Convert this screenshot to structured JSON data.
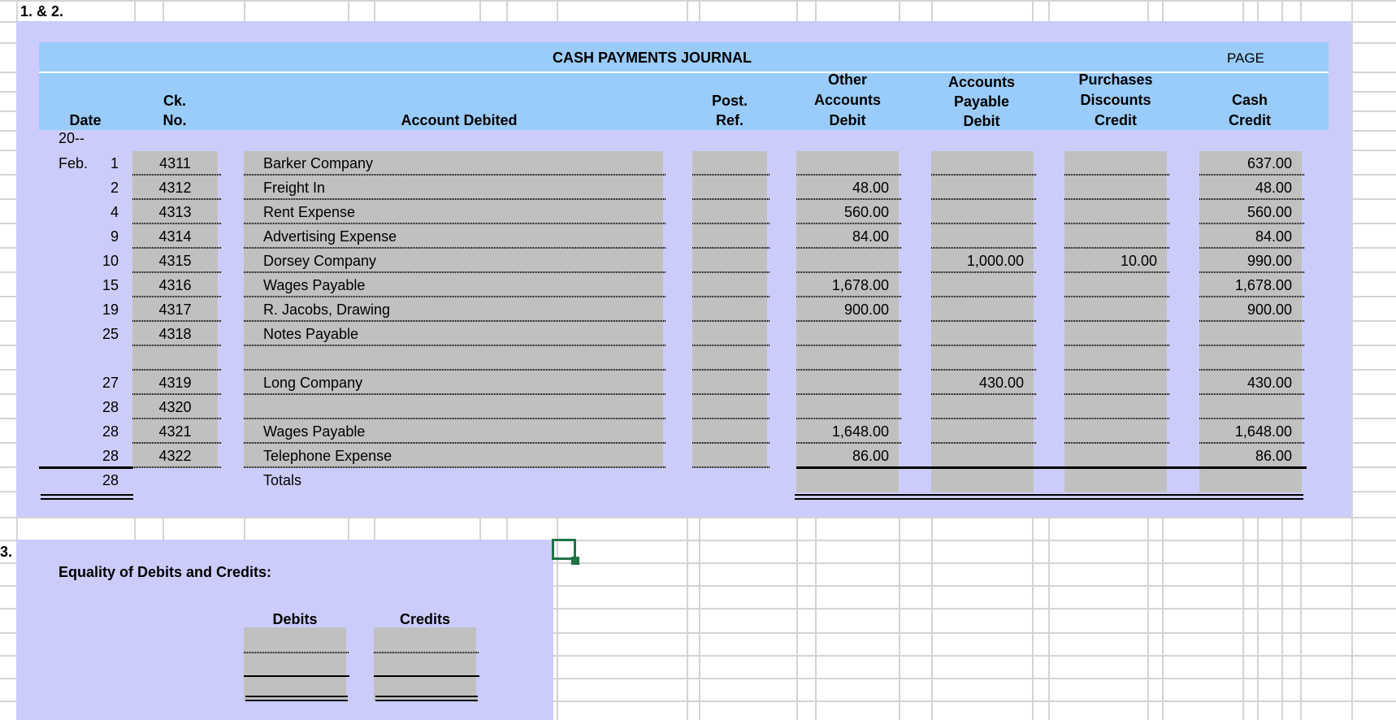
{
  "labels": {
    "part_1_2": "1. & 2.",
    "part_3": "3."
  },
  "journal": {
    "title": "CASH PAYMENTS JOURNAL",
    "page_label": "PAGE",
    "headers": {
      "date": "Date",
      "ck_line1": "Ck.",
      "ck_line2": "No.",
      "account": "Account Debited",
      "post_line1": "Post.",
      "post_line2": "Ref.",
      "other_line1": "Other",
      "other_line2": "Accounts",
      "other_line3": "Debit",
      "ap_line1": "Accounts",
      "ap_line2": "Payable",
      "ap_line3": "Debit",
      "pd_line1": "Purchases",
      "pd_line2": "Discounts",
      "pd_line3": "Credit",
      "cash_line1": "Cash",
      "cash_line2": "Credit"
    },
    "year": "20--",
    "rows": [
      {
        "month": "Feb.",
        "day": "1",
        "ck": "4311",
        "account": "Barker Company",
        "post": "",
        "other": "",
        "ap": "",
        "pd": "",
        "cash": "637.00"
      },
      {
        "month": "",
        "day": "2",
        "ck": "4312",
        "account": "Freight In",
        "post": "",
        "other": "48.00",
        "ap": "",
        "pd": "",
        "cash": "48.00"
      },
      {
        "month": "",
        "day": "4",
        "ck": "4313",
        "account": "Rent Expense",
        "post": "",
        "other": "560.00",
        "ap": "",
        "pd": "",
        "cash": "560.00"
      },
      {
        "month": "",
        "day": "9",
        "ck": "4314",
        "account": "Advertising Expense",
        "post": "",
        "other": "84.00",
        "ap": "",
        "pd": "",
        "cash": "84.00"
      },
      {
        "month": "",
        "day": "10",
        "ck": "4315",
        "account": "Dorsey Company",
        "post": "",
        "other": "",
        "ap": "1,000.00",
        "pd": "10.00",
        "cash": "990.00"
      },
      {
        "month": "",
        "day": "15",
        "ck": "4316",
        "account": "Wages Payable",
        "post": "",
        "other": "1,678.00",
        "ap": "",
        "pd": "",
        "cash": "1,678.00"
      },
      {
        "month": "",
        "day": "19",
        "ck": "4317",
        "account": "R. Jacobs, Drawing",
        "post": "",
        "other": "900.00",
        "ap": "",
        "pd": "",
        "cash": "900.00"
      },
      {
        "month": "",
        "day": "25",
        "ck": "4318",
        "account": "Notes Payable",
        "post": "",
        "other": "",
        "ap": "",
        "pd": "",
        "cash": ""
      },
      {
        "month": "",
        "day": "",
        "ck": "",
        "account": "",
        "post": "",
        "other": "",
        "ap": "",
        "pd": "",
        "cash": ""
      },
      {
        "month": "",
        "day": "27",
        "ck": "4319",
        "account": "Long Company",
        "post": "",
        "other": "",
        "ap": "430.00",
        "pd": "",
        "cash": "430.00"
      },
      {
        "month": "",
        "day": "28",
        "ck": "4320",
        "account": "",
        "post": "",
        "other": "",
        "ap": "",
        "pd": "",
        "cash": ""
      },
      {
        "month": "",
        "day": "28",
        "ck": "4321",
        "account": "Wages Payable",
        "post": "",
        "other": "1,648.00",
        "ap": "",
        "pd": "",
        "cash": "1,648.00"
      },
      {
        "month": "",
        "day": "28",
        "ck": "4322",
        "account": "Telephone Expense",
        "post": "",
        "other": "86.00",
        "ap": "",
        "pd": "",
        "cash": "86.00"
      }
    ],
    "totals": {
      "day": "28",
      "label": "Totals",
      "other": "",
      "ap": "",
      "pd": "",
      "cash": ""
    }
  },
  "equality": {
    "title": "Equality of Debits and Credits:",
    "debits_label": "Debits",
    "credits_label": "Credits",
    "debits": [
      "",
      "",
      ""
    ],
    "credits": [
      "",
      "",
      ""
    ]
  },
  "colors": {
    "band": "#ccccfc",
    "header": "#99ccfb",
    "input_cell": "#c0c0c0",
    "selection": "#217346",
    "gridline": "#d4d4d4"
  }
}
